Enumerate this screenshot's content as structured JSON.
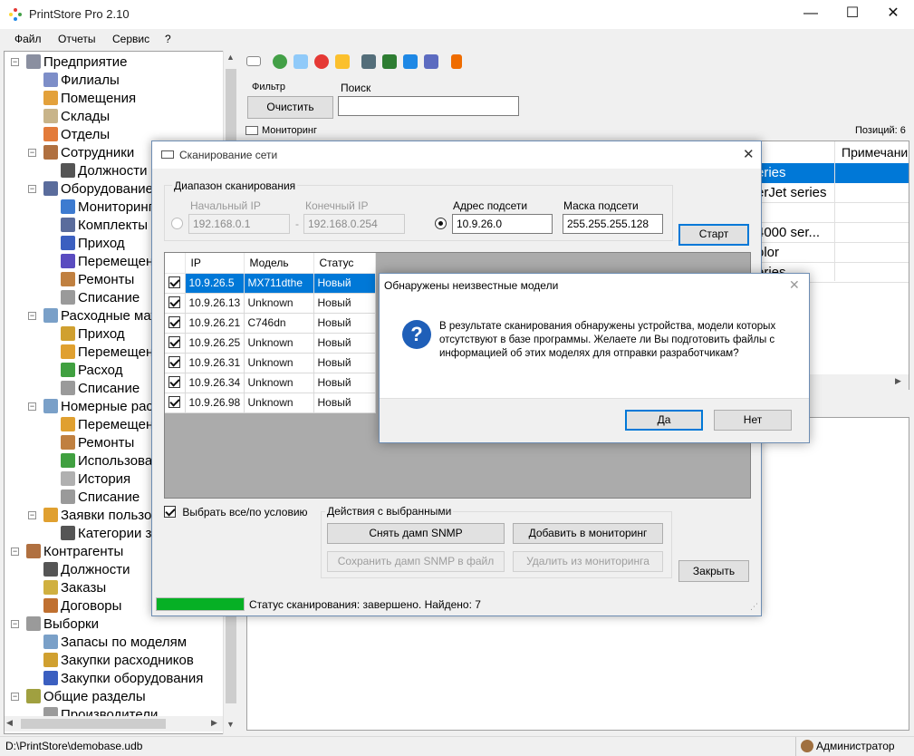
{
  "window": {
    "title": "PrintStore Pro 2.10",
    "minimize": "—",
    "maximize": "☐",
    "close": "✕"
  },
  "menu": [
    "Файл",
    "Отчеты",
    "Сервис",
    "?"
  ],
  "tree": [
    {
      "label": "Предприятие",
      "icon": "building-icon",
      "color": "#8a8fa0"
    },
    {
      "label": "Филиалы",
      "icon": "branch-icon",
      "color": "#7d8ec8"
    },
    {
      "label": "Помещения",
      "icon": "room-icon",
      "color": "#e3a13b"
    },
    {
      "label": "Склады",
      "icon": "warehouse-icon",
      "color": "#c8b48a"
    },
    {
      "label": "Отделы",
      "icon": "department-icon",
      "color": "#e37b3b"
    },
    {
      "label": "Сотрудники",
      "icon": "employee-icon",
      "color": "#b07040"
    },
    {
      "label": "Должности",
      "icon": "position-icon",
      "color": "#555"
    },
    {
      "label": "Оборудование",
      "icon": "equipment-icon",
      "color": "#5a6c9c"
    },
    {
      "label": "Мониторинг",
      "icon": "monitor-icon",
      "color": "#3d7bd0"
    },
    {
      "label": "Комплекты",
      "icon": "kit-icon",
      "color": "#5a6c9c"
    },
    {
      "label": "Приход",
      "icon": "truck-icon",
      "color": "#3b5fc0"
    },
    {
      "label": "Перемещение",
      "icon": "cart-icon",
      "color": "#5a4cc0"
    },
    {
      "label": "Ремонты",
      "icon": "repair-icon",
      "color": "#c08040"
    },
    {
      "label": "Списание",
      "icon": "writeoff-icon",
      "color": "#9a9a9a"
    },
    {
      "label": "Расходные материалы",
      "icon": "supplies-icon",
      "color": "#7aa0c8"
    },
    {
      "label": "Приход",
      "icon": "truck-icon",
      "color": "#d0a030"
    },
    {
      "label": "Перемещение",
      "icon": "cart-icon",
      "color": "#e0a030"
    },
    {
      "label": "Расход",
      "icon": "consumption-icon",
      "color": "#40a040"
    },
    {
      "label": "Списание",
      "icon": "writeoff-icon",
      "color": "#9a9a9a"
    },
    {
      "label": "Номерные расходники",
      "icon": "numbered-icon",
      "color": "#7aa0c8"
    },
    {
      "label": "Перемещение",
      "icon": "cart-icon",
      "color": "#e0a030"
    },
    {
      "label": "Ремонты",
      "icon": "repair-icon",
      "color": "#c08040"
    },
    {
      "label": "Использование",
      "icon": "usage-icon",
      "color": "#40a040"
    },
    {
      "label": "История",
      "icon": "history-icon",
      "color": "#b0b0b0"
    },
    {
      "label": "Списание",
      "icon": "writeoff-icon",
      "color": "#9a9a9a"
    },
    {
      "label": "Заявки пользователей",
      "icon": "request-icon",
      "color": "#e0a030"
    },
    {
      "label": "Категории заявок",
      "icon": "category-icon",
      "color": "#555"
    },
    {
      "label": "Контрагенты",
      "icon": "contractor-icon",
      "color": "#b07040"
    },
    {
      "label": "Должности",
      "icon": "position-icon",
      "color": "#555"
    },
    {
      "label": "Заказы",
      "icon": "order-icon",
      "color": "#d0b040"
    },
    {
      "label": "Договоры",
      "icon": "contract-icon",
      "color": "#c07030"
    },
    {
      "label": "Выборки",
      "icon": "selection-icon",
      "color": "#9a9a9a"
    },
    {
      "label": "Запасы по моделям",
      "icon": "stock-icon",
      "color": "#7aa0c8"
    },
    {
      "label": "Закупки расходников",
      "icon": "purchase-icon",
      "color": "#d0a030"
    },
    {
      "label": "Закупки оборудования",
      "icon": "purchase-equipment-icon",
      "color": "#3b5fc0"
    },
    {
      "label": "Общие разделы",
      "icon": "common-icon",
      "color": "#a0a040"
    },
    {
      "label": "Производители",
      "icon": "manufacturer-icon",
      "color": "#9a9a9a"
    }
  ],
  "filter": {
    "label": "Фильтр",
    "clear_button": "Очистить",
    "search_label": "Поиск",
    "search_value": ""
  },
  "monitoring_label": "Мониторинг",
  "positions": "Позиций: 6",
  "bg_grid": {
    "col_header": "Примечани",
    "rows": [
      "eries",
      "erJet series",
      "",
      "4000 ser...",
      "olor",
      "eries"
    ]
  },
  "scan": {
    "title": "Сканирование сети",
    "range_group": "Диапазон сканирования",
    "start_ip_label": "Начальный IP",
    "start_ip": "192.168.0.1",
    "end_ip_label": "Конечный IP",
    "end_ip": "192.168.0.254",
    "dash": "-",
    "subnet_label": "Адрес подсети",
    "subnet": "10.9.26.0",
    "mask_label": "Маска подсети",
    "mask": "255.255.255.128",
    "start_button": "Старт",
    "columns": [
      "IP",
      "Модель",
      "Статус"
    ],
    "rows": [
      {
        "ip": "10.9.26.5",
        "model": "MX711dthe",
        "status": "Новый"
      },
      {
        "ip": "10.9.26.13",
        "model": "Unknown",
        "status": "Новый"
      },
      {
        "ip": "10.9.26.21",
        "model": "C746dn",
        "status": "Новый"
      },
      {
        "ip": "10.9.26.25",
        "model": "Unknown",
        "status": "Новый"
      },
      {
        "ip": "10.9.26.31",
        "model": "Unknown",
        "status": "Новый"
      },
      {
        "ip": "10.9.26.34",
        "model": "Unknown",
        "status": "Новый"
      },
      {
        "ip": "10.9.26.98",
        "model": "Unknown",
        "status": "Новый"
      }
    ],
    "select_all": "Выбрать все/по условию",
    "actions_group": "Действия с выбранными",
    "dump_snmp": "Снять дамп SNMP",
    "add_monitoring": "Добавить в мониторинг",
    "save_dump": "Сохранить дамп SNMP в файл",
    "remove_monitoring": "Удалить из мониторинга",
    "close_button": "Закрыть",
    "status_text": "Статус сканирования: завершено. Найдено: 7",
    "progress": 1.0
  },
  "msgbox": {
    "title": "Обнаружены неизвестные модели",
    "text": "В результате сканирования обнаружены устройства, модели которых отсутствуют в базе программы. Желаете ли Вы подготовить файлы с информацией об этих моделях для отправки разработчикам?",
    "yes": "Да",
    "no": "Нет",
    "icon": "question-icon"
  },
  "statusbar": {
    "path": "D:\\PrintStore\\demobase.udb",
    "user": "Администратор"
  },
  "colors": {
    "accent": "#0078d7",
    "progress": "#06b025"
  }
}
